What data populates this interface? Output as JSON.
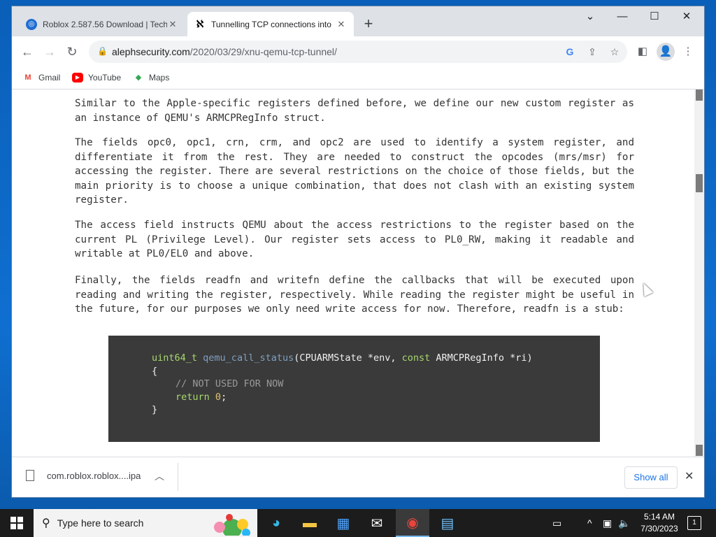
{
  "browser": {
    "tabs": [
      {
        "title": "Roblox 2.587.56 Download | Tech",
        "icon": "roblox-favicon"
      },
      {
        "title": "Tunnelling TCP connections into",
        "icon": "aleph-favicon"
      }
    ],
    "new_tab_label": "+",
    "url_domain": "alephsecurity.com",
    "url_path": "/2020/03/29/xnu-qemu-tcp-tunnel/",
    "bookmarks": [
      "Gmail",
      "YouTube",
      "Maps"
    ]
  },
  "article": {
    "p1": "Similar to the Apple-specific registers defined before, we define our new custom register as an instance of QEMU's ARMCPRegInfo struct.",
    "p2": "The fields opc0, opc1, crn, crm, and opc2 are used to identify a system register, and differentiate it from the rest. They are needed to construct the opcodes (mrs/msr) for accessing the register. There are several restrictions on the choice of those fields, but the main priority is to choose a unique combination, that does not clash with an existing system register.",
    "p3": "The access field instructs QEMU about the access restrictions to the register based on the current PL (Privilege Level). Our register sets access to PL0_RW, making it readable and writable at PL0/EL0 and above.",
    "p4": "Finally, the fields readfn and writefn define the callbacks that will be executed upon reading and writing the register, respectively. While reading the register might be useful in the future, for our purposes we only need write access for now. Therefore, readfn is a stub:",
    "code": {
      "l1_type": "uint64_t",
      "l1_fn": "qemu_call_status",
      "l1_args_a": "(CPUARMState *env, ",
      "l1_const": "const",
      "l1_args_b": " ARMCPRegInfo *ri)",
      "l2": "{",
      "l3_comment": "// NOT USED FOR NOW",
      "l4_ret": "return",
      "l4_num": "0",
      "l4_end": ";",
      "l5": "}"
    }
  },
  "scroll": {
    "position_fraction": 0.3
  },
  "downloads": {
    "file_name": "com.roblox.roblox....ipa",
    "show_all_label": "Show all"
  },
  "taskbar": {
    "search_placeholder": "Type here to search",
    "time": "5:14 AM",
    "date": "7/30/2023",
    "notification_count": "1"
  },
  "colors": {
    "code_background": "#3a3a3a",
    "code_keyword": "#a8d86e",
    "code_function": "#7f9fc0",
    "link_blue": "#1a73e8"
  }
}
